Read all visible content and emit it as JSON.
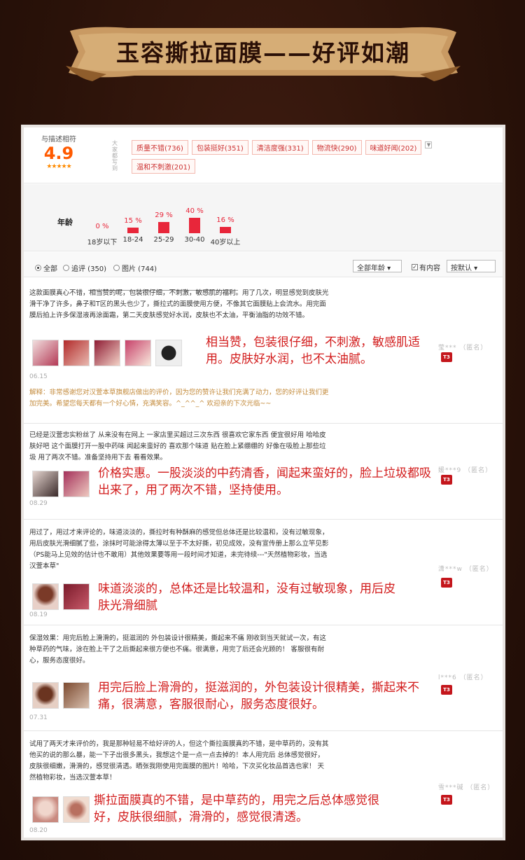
{
  "banner": {
    "title": "玉容撕拉面膜——好评如潮"
  },
  "summary": {
    "score_label": "与描述相符",
    "score": "4.9",
    "stars": "★★★★★",
    "impression_label": "大家都写到",
    "tags": [
      "质量不错(736)",
      "包装挺好(351)",
      "清洁度强(331)",
      "物流快(290)",
      "味道好闻(202)",
      "温和不刺激(201)"
    ],
    "more_icon": "chevron-down-icon"
  },
  "age": {
    "title": "年龄",
    "categories": [
      "18岁以下",
      "18-24",
      "25-29",
      "30-40",
      "40岁以上"
    ],
    "labels": [
      "0 %",
      "15 %",
      "29 %",
      "40 %",
      "16 %"
    ]
  },
  "chart_data": {
    "type": "bar",
    "categories": [
      "18岁以下",
      "18-24",
      "25-29",
      "30-40",
      "40岁以上"
    ],
    "values": [
      0,
      15,
      29,
      40,
      16
    ],
    "title": "年龄",
    "xlabel": "",
    "ylabel": "",
    "colors": [
      "#e8263a"
    ]
  },
  "filter": {
    "all": "全部",
    "append": "追评 (350)",
    "photo": "图片 (744)",
    "age_select": "全部年龄 ▾",
    "has_content": "有内容",
    "sort": "按默认 ▾"
  },
  "reviews": [
    {
      "text": "这款面膜真心不错，相当赞的呢，包装很仔细，不刺激，敏感肌的福利。用了几次，明显感觉到皮肤光滑干净了许多，鼻子和T区的黑头也少了，撕拉式的面膜使用方便，不像其它面膜贴上会流水。用完面膜后拍上许多保湿液再涂面霜，第二天皮肤感觉好水润，皮肤也不太油，平衡油脂的功效不错。",
      "overlay": "相当赞，包装很仔细，不刺激，敏感肌适用。皮肤好水润，也不太油腻。",
      "date": "06.15",
      "reply": "解释：非常感谢您对汉萱本草旗舰店做出的评价，因为您的赞许让我们充满了动力，您的好评让我们更加完美。希望您每天都有一个好心情，充满笑容。^_^^_^ 欢迎亲的下次光临~~",
      "user": "莹*** （匿名）",
      "badge": "T3"
    },
    {
      "text": "已经是汉萱忠实粉丝了 从来没有在网上 一家店里买超过三次东西 很喜欢它家东西 便宜很好用 哈哈皮肤好吧 这个面膜打开一股中药味 闻起来蛮好的 喜欢那个味道 贴在脸上紧绷绷的 好像在吸脸上那些垃圾 用了两次不错。准备坚持用下去 看看效果。",
      "overlay": "价格实惠。一股淡淡的中药清香，闻起来蛮好的，脸上垃圾都吸出来了，用了两次不错，坚持使用。",
      "date": "08.29",
      "user": "媛***9 （匿名）",
      "badge": "T3"
    },
    {
      "text": "用过了，用过才来评论的，味道淡淡的，撕拉时有种酥麻的感觉但总体还是比较温和，没有过敏现象，用后皮肤光滑细腻了些，涂抹时可能涂得太薄以至于不太好撕，初见成效，没有宣传册上那么立竿见影（PS能马上见效的估计也不敢用）其他效果要等用一段时间才知道，未完待续---\"天然植物彩妆，当选汉萱本草\"",
      "overlay": "味道淡淡的，总体还是比较温和，没有过敏现象，用后皮肤光滑细腻",
      "date": "08.19",
      "user": "潇***w （匿名）",
      "badge": "T3"
    },
    {
      "text": "保湿效果：用完后脸上滑滑的，挺滋润的 外包装设计很精美，撕起来不痛 刚收到当天就试一次，有这种草药的气味，涂在脸上干了之后撕起来很方便也不痛。很满意，用完了后还会光顾的！ 客服很有耐心，服务态度很好。",
      "overlay": "用完后脸上滑滑的，挺滋润的，外包装设计很精美，撕起来不痛，很满意，客服很耐心，服务态度很好。",
      "date": "07.31",
      "user": "l***6 （匿名）",
      "badge": "T3"
    },
    {
      "text": "试用了两天才来评价的，我是那种轻易不给好评的人，但这个撕拉面膜真的不错，是中草药的，没有其他买的说的那么暴，能一下子出很多黑头，我想这个是一点一点去掉的！本人用完后 总体感觉很好，皮肤很细嫩，滑滑的，感觉很清透。晒张我刚使用完面膜的图片！哈哈，下次买化妆品首选也家！ 天然植物彩妆，当选汉萱本草！",
      "overlay": "撕拉面膜真的不错，是中草药的，用完之后总体感觉很好，皮肤很细腻，滑滑的，感觉很清透。",
      "date": "08.20",
      "user": "雪***碱 （匿名）",
      "badge": "T3"
    }
  ]
}
